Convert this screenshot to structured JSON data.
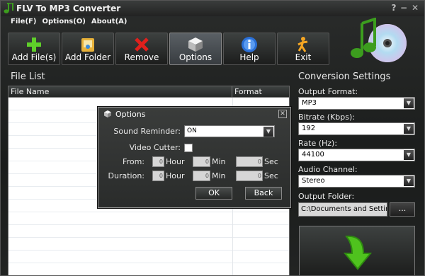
{
  "window": {
    "title": "FLV To MP3 Converter",
    "help": "?",
    "minimize": "−",
    "close": "✕"
  },
  "menu": [
    "File(F)",
    "Options(O)",
    "About(A)"
  ],
  "toolbar": [
    {
      "label": "Add File(s)",
      "icon": "add-icon"
    },
    {
      "label": "Add Folder",
      "icon": "folder-icon"
    },
    {
      "label": "Remove",
      "icon": "remove-icon"
    },
    {
      "label": "Options",
      "icon": "options-icon"
    },
    {
      "label": "Help",
      "icon": "help-icon"
    },
    {
      "label": "Exit",
      "icon": "exit-icon"
    }
  ],
  "file_list": {
    "title": "File List",
    "col_name": "File Name",
    "col_format": "Format"
  },
  "settings": {
    "title": "Conversion Settings",
    "output_format_label": "Output Format:",
    "output_format": "MP3",
    "bitrate_label": "Bitrate (Kbps):",
    "bitrate": "192",
    "rate_label": "Rate (Hz):",
    "rate": "44100",
    "channel_label": "Audio Channel:",
    "channel": "Stereo",
    "folder_label": "Output Folder:",
    "folder": "C:\\Documents and Settin",
    "browse": "..."
  },
  "dialog": {
    "title": "Options",
    "sound_reminder_label": "Sound Reminder:",
    "sound_reminder": "ON",
    "video_cutter_label": "Video Cutter:",
    "from_label": "From:",
    "duration_label": "Duration:",
    "hour": "Hour",
    "min": "Min",
    "sec": "Sec",
    "zero": "0",
    "ok": "OK",
    "back": "Back"
  },
  "colors": {
    "accent_green": "#3c9d1e",
    "disc_blue": "#9fd5f0"
  }
}
